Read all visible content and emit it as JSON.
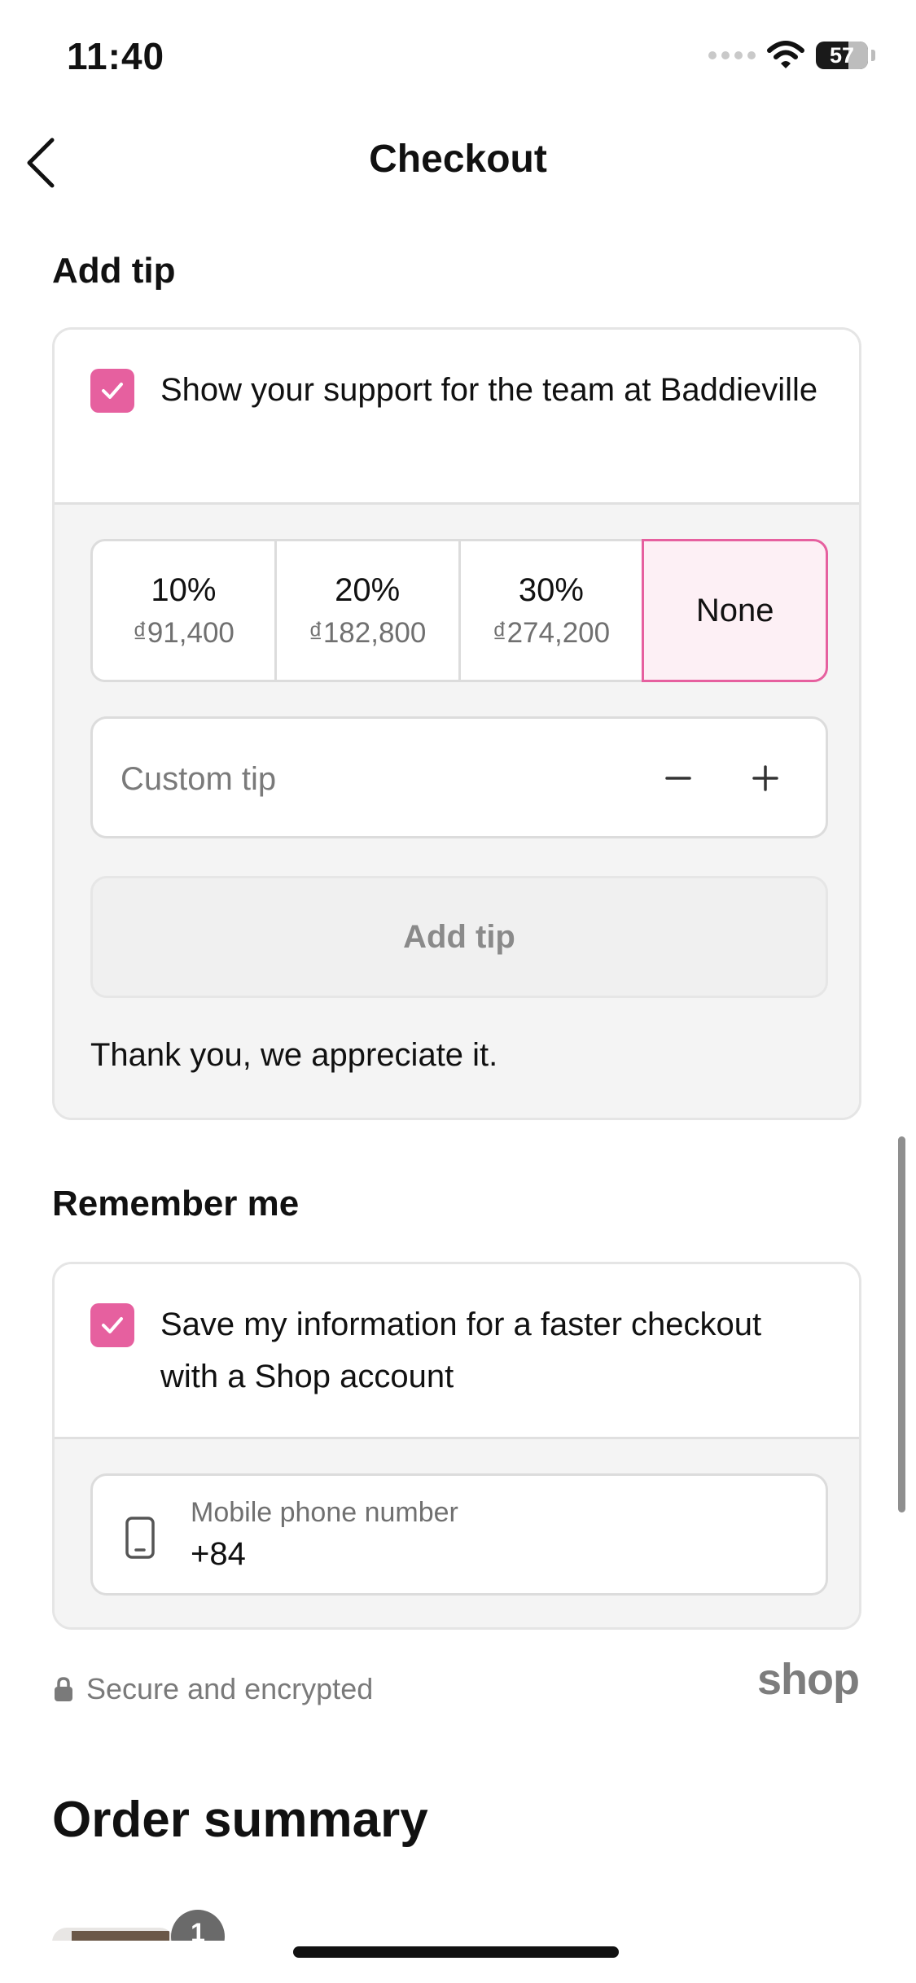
{
  "status_bar": {
    "time": "11:40",
    "battery": "57"
  },
  "nav": {
    "title": "Checkout"
  },
  "tip": {
    "section_title": "Add tip",
    "checkbox_label": "Show your support for the team at Baddieville",
    "checked": true,
    "options": [
      {
        "percent": "10%",
        "amount": "₫91,400"
      },
      {
        "percent": "20%",
        "amount": "₫182,800"
      },
      {
        "percent": "30%",
        "amount": "₫274,200"
      },
      {
        "label": "None",
        "selected": true
      }
    ],
    "custom_placeholder": "Custom tip",
    "add_button": "Add tip",
    "thanks": "Thank you, we appreciate it."
  },
  "remember": {
    "section_title": "Remember me",
    "checkbox_label": "Save my information for a faster checkout with a Shop account",
    "checked": true,
    "phone_label": "Mobile phone number",
    "phone_value": "+84"
  },
  "footer": {
    "secure_text": "Secure and encrypted",
    "brand": "shop"
  },
  "order_summary": {
    "title": "Order summary",
    "item_quantity": "1"
  },
  "colors": {
    "accent": "#e6609f",
    "selected_bg": "#fdf0f5"
  }
}
